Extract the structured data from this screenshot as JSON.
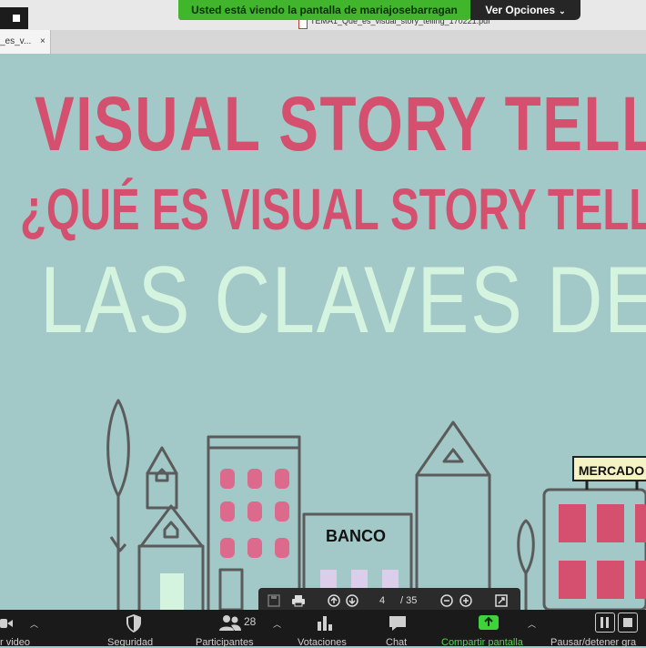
{
  "share_banner": {
    "text": "Usted está viendo la pantalla de mariajosebarragan"
  },
  "view_options": {
    "label": "Ver Opciones",
    "caret": "⌄"
  },
  "file_title": "TEMA1_Que_es_visual_story_telling_170221.pdf",
  "tab": {
    "label": "_es_v...",
    "close": "×"
  },
  "slide": {
    "heading1": "VISUAL STORY TELLI",
    "heading2": "¿QUÉ ES VISUAL STORY TELL",
    "heading3": "LAS CLAVES DEL V",
    "bank_sign": "BANCO",
    "market_sign": "MERCADO"
  },
  "pdf_toolbar": {
    "page": "4",
    "total": "/ 35"
  },
  "zoom_toolbar": {
    "video_label": "r video",
    "security_label": "Seguridad",
    "participants_label": "Participantes",
    "participants_count": "28",
    "polls_label": "Votaciones",
    "chat_label": "Chat",
    "share_label": "Compartir pantalla",
    "pause_label": "Pausar/detener gra"
  },
  "colors": {
    "slide_bg": "#a3c8c8",
    "title_pink": "#d4506e",
    "mint": "#d5f4df",
    "share_green": "#41b52c"
  }
}
